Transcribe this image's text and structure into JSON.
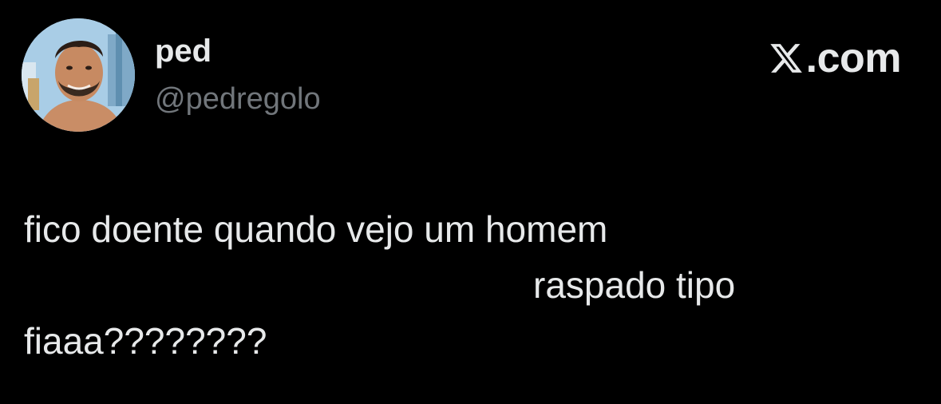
{
  "author": {
    "display_name": "ped",
    "handle": "@pedregolo"
  },
  "brand": {
    "label": ".com",
    "icon": "x-logo-icon"
  },
  "tweet": {
    "lines": [
      "fico doente quando vejo um homem",
      "raspado tipo",
      "fiaaa????????"
    ]
  },
  "colors": {
    "background": "#000000",
    "primary_text": "#e7e9ea",
    "secondary_text": "#71767b"
  }
}
